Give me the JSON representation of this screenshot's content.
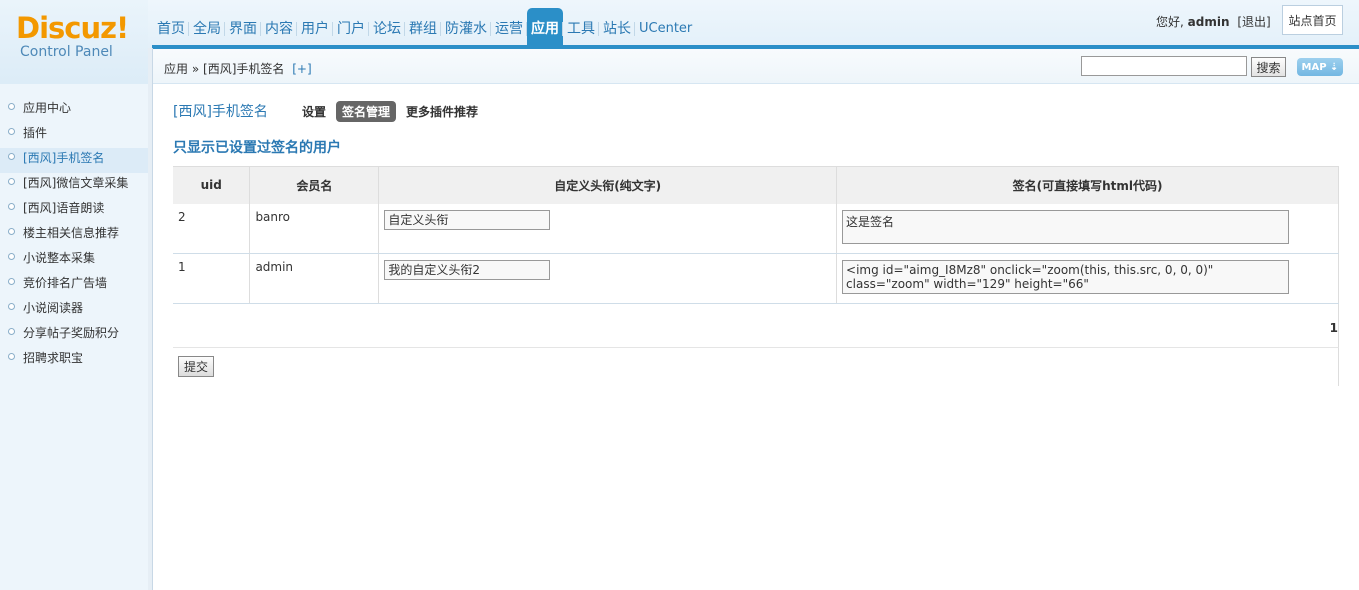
{
  "logo": {
    "name": "Discuz!",
    "subtitle": "Control Panel"
  },
  "nav": [
    "首页",
    "全局",
    "界面",
    "内容",
    "用户",
    "门户",
    "论坛",
    "群组",
    "防灌水",
    "运营",
    "应用",
    "工具",
    "站长",
    "UCenter"
  ],
  "nav_active": "应用",
  "user": {
    "greeting": "您好,",
    "username": "admin",
    "logout": "[退出]",
    "home_button": "站点首页"
  },
  "breadcrumb": {
    "root": "应用",
    "sep": "»",
    "current": "[西风]手机签名",
    "plus": "[+]"
  },
  "search": {
    "button": "搜索",
    "map": "MAP ⇣"
  },
  "sidebar": [
    "应用中心",
    "插件",
    "[西风]手机签名",
    "[西风]微信文章采集",
    "[西风]语音朗读",
    "楼主相关信息推荐",
    "小说整本采集",
    "竞价排名广告墙",
    "小说阅读器",
    "分享帖子奖励积分",
    "招聘求职宝"
  ],
  "sidebar_active": "[西风]手机签名",
  "plugin": {
    "title": "[西风]手机签名",
    "tabs": [
      "设置",
      "签名管理",
      "更多插件推荐"
    ],
    "active_tab": "签名管理",
    "subheading": "只显示已设置过签名的用户"
  },
  "table": {
    "headers": [
      "uid",
      "会员名",
      "自定义头衔(纯文字)",
      "签名(可直接填写html代码)"
    ],
    "rows": [
      {
        "uid": "2",
        "name": "banro",
        "title": "自定义头衔",
        "sign": "这是签名"
      },
      {
        "uid": "1",
        "name": "admin",
        "title": "我的自定义头衔2",
        "sign": "<img id=\"aimg_I8Mz8\" onclick=\"zoom(this, this.src, 0, 0, 0)\" class=\"zoom\" width=\"129\" height=\"66\""
      }
    ]
  },
  "pager": "1",
  "submit": "提交"
}
